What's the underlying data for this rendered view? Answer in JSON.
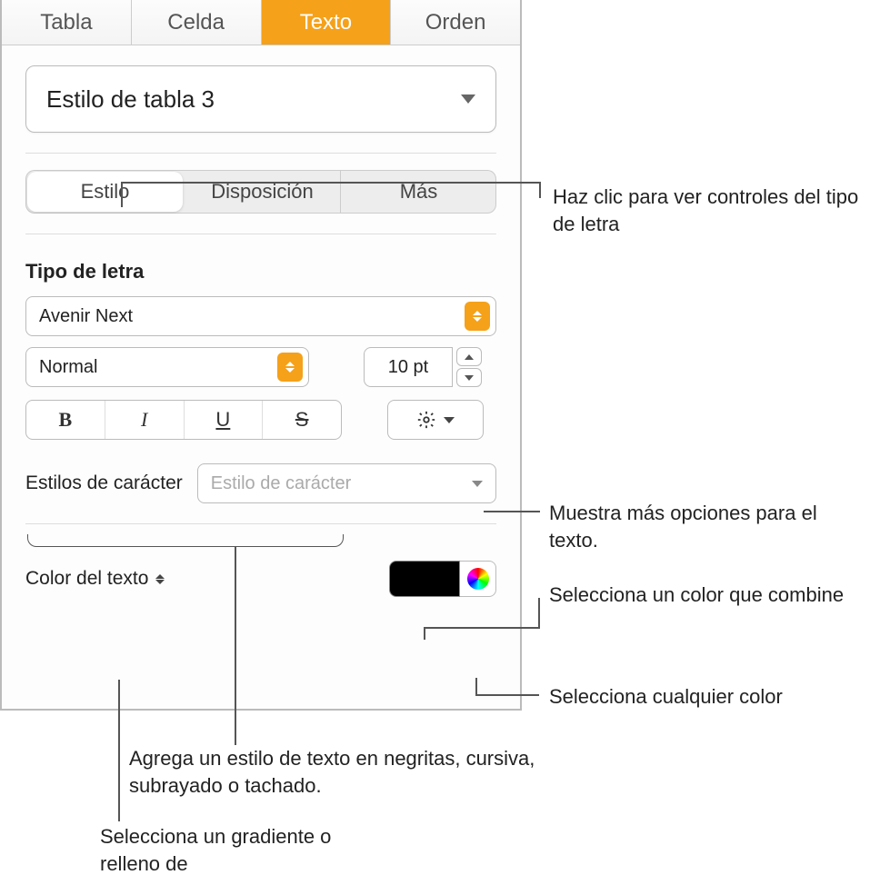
{
  "topTabs": {
    "tabla": "Tabla",
    "celda": "Celda",
    "texto": "Texto",
    "orden": "Orden"
  },
  "styleDropdown": {
    "value": "Estilo de tabla 3"
  },
  "segTabs": {
    "estilo": "Estilo",
    "disposicion": "Disposición",
    "mas": "Más"
  },
  "fontSection": {
    "label": "Tipo de letra",
    "fontFamily": "Avenir Next",
    "fontStyle": "Normal",
    "size": "10 pt"
  },
  "bius": {
    "b": "B",
    "i": "I",
    "u": "U",
    "s": "S"
  },
  "charStyle": {
    "label": "Estilos de carácter",
    "placeholder": "Estilo de carácter"
  },
  "colorRow": {
    "label": "Color del texto"
  },
  "callouts": {
    "fontControls": "Haz clic para ver controles del tipo de letra",
    "moreOptions": "Muestra más opciones para el texto.",
    "matchColor": "Selecciona un color que combine",
    "anyColor": "Selecciona cualquier color",
    "bius": "Agrega un estilo de texto en negritas, cursiva, subrayado o tachado.",
    "gradient": "Selecciona un gradiente o relleno de"
  }
}
